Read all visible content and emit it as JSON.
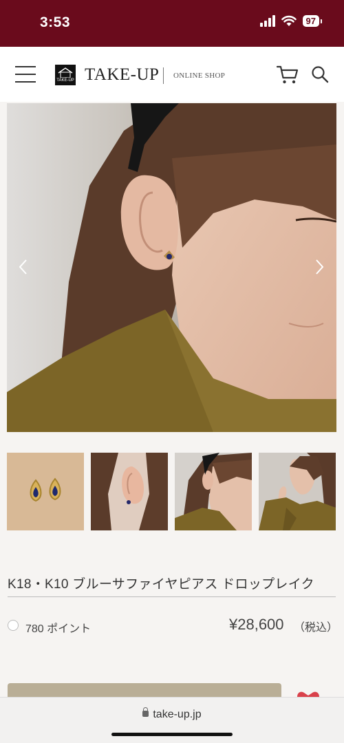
{
  "status_bar": {
    "time": "3:53",
    "battery": "97"
  },
  "header": {
    "logo_mark_text": "TAKE-UP",
    "logo_text": "TAKE-UP",
    "logo_sub": "ONLINE SHOP",
    "icons": [
      "menu-icon",
      "cart-icon",
      "search-icon"
    ]
  },
  "gallery": {
    "main_image": "earring-model-closeup",
    "thumbnails": [
      "earrings-product",
      "ear-closeup",
      "model-side",
      "model-pose"
    ],
    "icons": [
      "chevron-left-icon",
      "chevron-right-icon"
    ]
  },
  "product": {
    "title": "K18・K10 ブルーサファイヤピアス ドロップレイク",
    "points": "780 ポイント",
    "price": "¥28,600",
    "tax": "（税込）"
  },
  "browser": {
    "url": "take-up.jp"
  },
  "colors": {
    "status_bar": "#6a0b1c",
    "cart_button": "#b9ae96",
    "heart": "#d9414b"
  }
}
